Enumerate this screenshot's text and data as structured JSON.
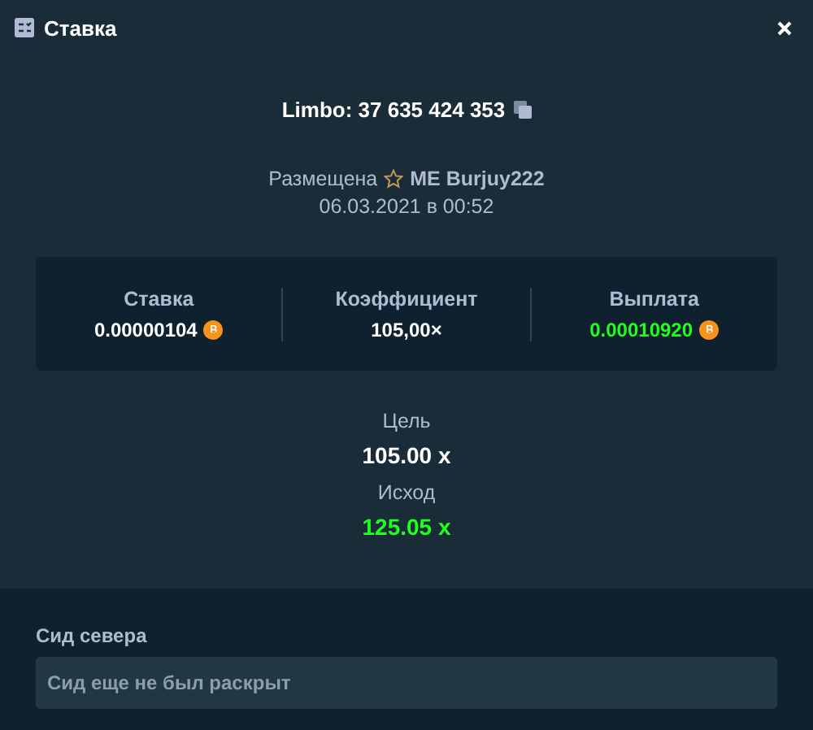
{
  "window": {
    "title": "Ставка"
  },
  "bet": {
    "title": "Limbo: 37 635 424 353",
    "placed_label": "Размещена",
    "user": "ME Burjuy222",
    "date": "06.03.2021 в 00:52"
  },
  "stats": [
    {
      "label": "Ставка",
      "value": "0.00000104",
      "positive": false,
      "currency": true
    },
    {
      "label": "Коэффициент",
      "value": "105,00×",
      "positive": false,
      "currency": false
    },
    {
      "label": "Выплата",
      "value": "0.00010920",
      "positive": true,
      "currency": true
    }
  ],
  "results": [
    {
      "label": "Цель",
      "value": "105.00 x",
      "positive": false
    },
    {
      "label": "Исход",
      "value": "125.05 x",
      "positive": true
    }
  ],
  "server_seed": {
    "label": "Сид севера",
    "value": "Сид еще не был раскрыт"
  }
}
